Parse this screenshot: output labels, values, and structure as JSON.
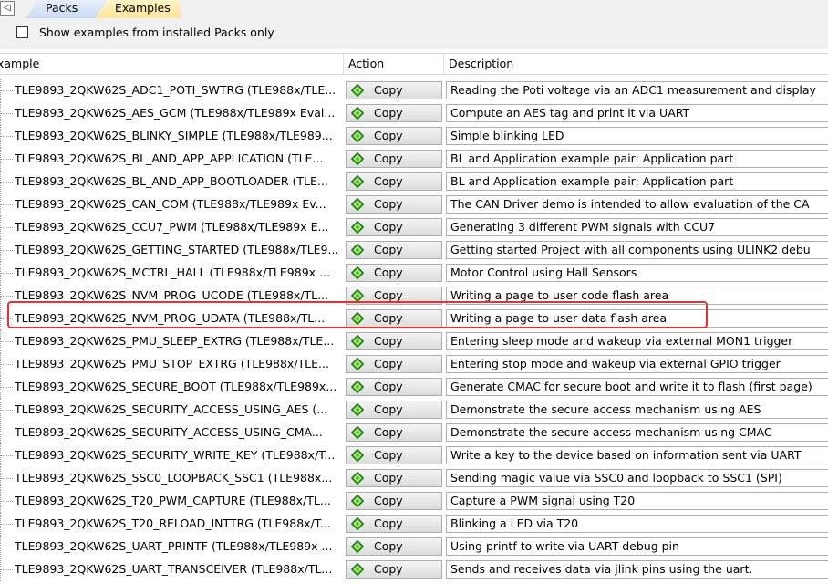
{
  "tabs": [
    {
      "label": "Packs",
      "active": false
    },
    {
      "label": "Examples",
      "active": true
    }
  ],
  "tab_scroll_glyph": "◁",
  "filter": {
    "label": "Show examples from installed Packs only",
    "checked": false
  },
  "columns": {
    "example": "xample",
    "action": "Action",
    "description": "Description"
  },
  "copy_label": "Copy",
  "selected_row_index": 10,
  "highlight_color": "#e53232",
  "rows": [
    {
      "example": "TLE9893_2QKW62S_ADC1_POTI_SWTRG (TLE988x/TLE...",
      "description": "Reading the Poti voltage via an ADC1 measurement and display"
    },
    {
      "example": "TLE9893_2QKW62S_AES_GCM (TLE988x/TLE989x Eval...",
      "description": "Compute an AES tag and print it via UART"
    },
    {
      "example": "TLE9893_2QKW62S_BLINKY_SIMPLE (TLE988x/TLE989...",
      "description": "Simple blinking LED"
    },
    {
      "example": "TLE9893_2QKW62S_BL_AND_APP_APPLICATION (TLE...",
      "description": "BL and Application example pair: Application part"
    },
    {
      "example": "TLE9893_2QKW62S_BL_AND_APP_BOOTLOADER (TLE...",
      "description": "BL and Application example pair: Application part"
    },
    {
      "example": "TLE9893_2QKW62S_CAN_COM (TLE988x/TLE989x Ev...",
      "description": "The CAN Driver demo is intended to allow evaluation of the CA"
    },
    {
      "example": "TLE9893_2QKW62S_CCU7_PWM (TLE988x/TLE989x E...",
      "description": "Generating 3 different PWM signals with CCU7"
    },
    {
      "example": "TLE9893_2QKW62S_GETTING_STARTED (TLE988x/TLE9...",
      "description": "Getting started Project with all components using ULINK2 debu"
    },
    {
      "example": "TLE9893_2QKW62S_MCTRL_HALL (TLE988x/TLE989x ...",
      "description": "Motor Control using Hall Sensors"
    },
    {
      "example": "TLE9893_2QKW62S_NVM_PROG_UCODE (TLE988x/TL...",
      "description": "Writing a page to user code flash area"
    },
    {
      "example": "TLE9893_2QKW62S_NVM_PROG_UDATA (TLE988x/TL...",
      "description": "Writing a page to user data flash area"
    },
    {
      "example": "TLE9893_2QKW62S_PMU_SLEEP_EXTRG (TLE988x/TLE...",
      "description": "Entering sleep mode and wakeup via external MON1 trigger"
    },
    {
      "example": "TLE9893_2QKW62S_PMU_STOP_EXTRG (TLE988x/TLE...",
      "description": "Entering stop mode and wakeup via external GPIO trigger"
    },
    {
      "example": "TLE9893_2QKW62S_SECURE_BOOT (TLE988x/TLE989x...",
      "description": "Generate CMAC for secure boot and write it to flash (first page)"
    },
    {
      "example": "TLE9893_2QKW62S_SECURITY_ACCESS_USING_AES (...",
      "description": "Demonstrate the secure access mechanism using AES"
    },
    {
      "example": "TLE9893_2QKW62S_SECURITY_ACCESS_USING_CMA...",
      "description": "Demonstrate the secure access mechanism using CMAC"
    },
    {
      "example": "TLE9893_2QKW62S_SECURITY_WRITE_KEY (TLE988x/T...",
      "description": "Write a key to the device based on information sent via UART"
    },
    {
      "example": "TLE9893_2QKW62S_SSC0_LOOPBACK_SSC1 (TLE988x...",
      "description": "Sending magic value via SSC0 and loopback to SSC1 (SPI)"
    },
    {
      "example": "TLE9893_2QKW62S_T20_PWM_CAPTURE (TLE988x/TL...",
      "description": "Capture a PWM signal using T20"
    },
    {
      "example": "TLE9893_2QKW62S_T20_RELOAD_INTTRG (TLE988x/T...",
      "description": "Blinking a LED via T20"
    },
    {
      "example": "TLE9893_2QKW62S_UART_PRINTF (TLE988x/TLE989x ...",
      "description": "Using printf to write via UART debug pin"
    },
    {
      "example": "TLE9893_2QKW62S_UART_TRANSCEIVER (TLE988x/TL...",
      "description": "Sends and receives data via jlink pins using the uart."
    }
  ]
}
